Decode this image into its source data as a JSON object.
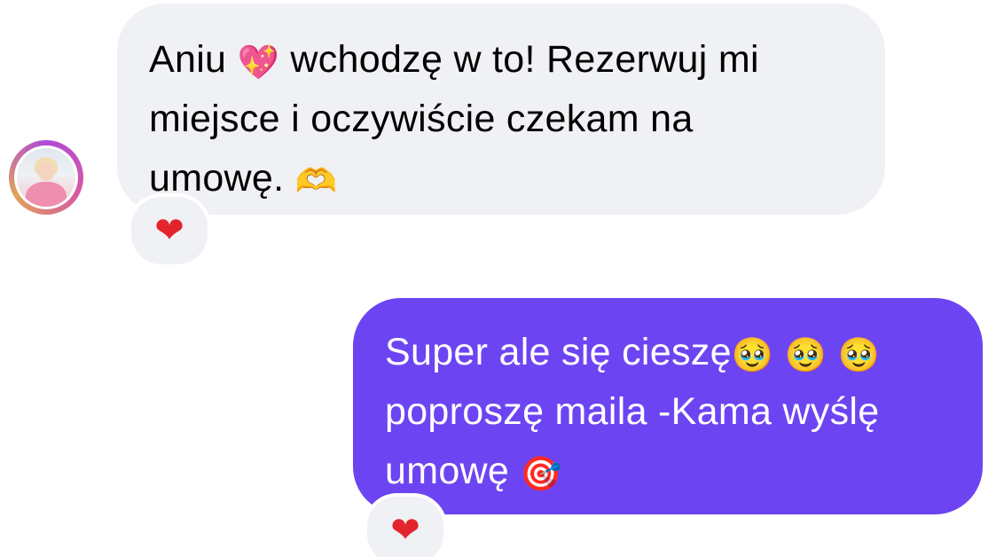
{
  "conversation": {
    "incoming": {
      "lines": [
        {
          "before": "Aniu ",
          "emoji": "💖",
          "after": " wchodzę w to! Rezerwuj mi"
        },
        {
          "text": "miejsce i oczywiście czekam na"
        },
        {
          "before": "umowę. ",
          "emoji": "🫶"
        }
      ],
      "reaction": "❤"
    },
    "outgoing": {
      "lines": [
        {
          "before": "Super ale się cieszę",
          "emoji": "🥹",
          "after": " ",
          "emoji2": "🥹",
          "after2": " ",
          "emoji3": "🥹"
        },
        {
          "text": "poproszę maila -Kama wyślę"
        },
        {
          "before": "umowę ",
          "emoji": "🎯"
        }
      ],
      "reaction": "❤"
    }
  },
  "icons": {
    "avatar": "profile-photo",
    "incoming_reaction": "red-heart-icon",
    "outgoing_reaction": "red-heart-icon"
  },
  "colors": {
    "incoming_bubble": "#f0f1f4",
    "outgoing_bubble": "#6d44f2",
    "outgoing_text": "#ffffff",
    "reaction_heart": "#e2252d"
  }
}
